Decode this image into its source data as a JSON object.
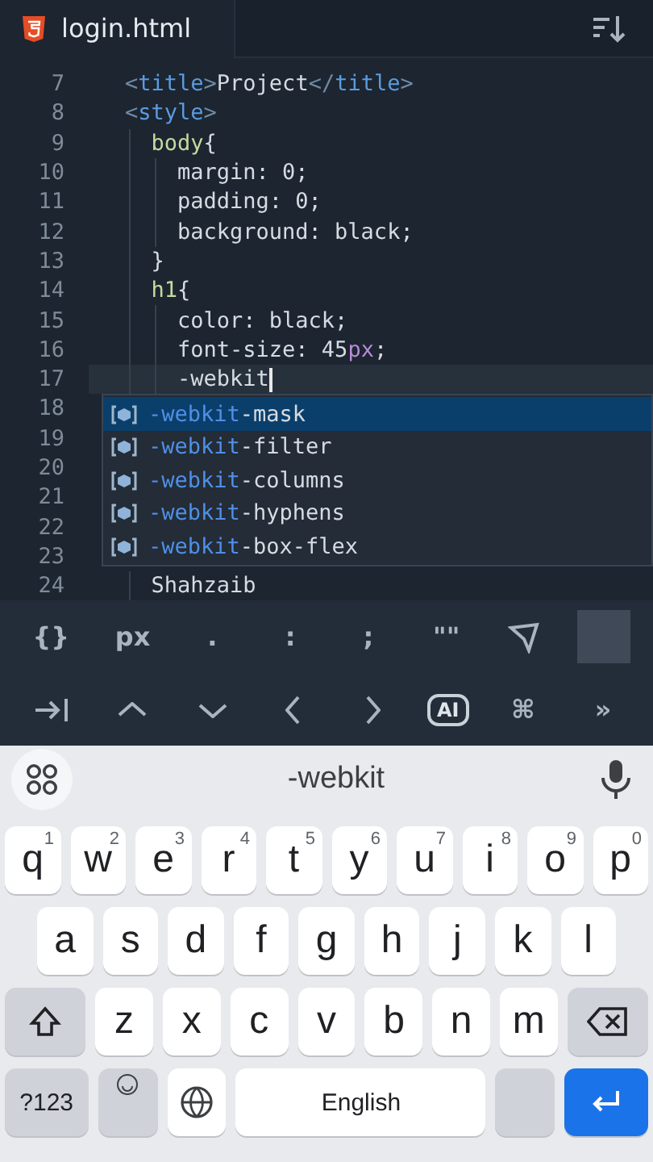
{
  "editor_tab": {
    "file_name": "login.html"
  },
  "code_lines": [
    {
      "number": "7",
      "tokens": [
        {
          "kind": "punct",
          "text": "    <"
        },
        {
          "kind": "tag",
          "text": "title"
        },
        {
          "kind": "punct",
          "text": ">"
        },
        {
          "kind": "text",
          "text": "Project"
        },
        {
          "kind": "punct",
          "text": "</"
        },
        {
          "kind": "tag",
          "text": "title"
        },
        {
          "kind": "punct",
          "text": ">"
        }
      ]
    },
    {
      "number": "8",
      "tokens": [
        {
          "kind": "punct",
          "text": "    <"
        },
        {
          "kind": "tag",
          "text": "style"
        },
        {
          "kind": "punct",
          "text": ">"
        }
      ]
    },
    {
      "number": "9",
      "tokens": [
        {
          "kind": "selector",
          "text": "      body"
        },
        {
          "kind": "text",
          "text": "{"
        }
      ]
    },
    {
      "number": "10",
      "tokens": [
        {
          "kind": "text",
          "text": "        margin: 0;"
        }
      ]
    },
    {
      "number": "11",
      "tokens": [
        {
          "kind": "text",
          "text": "        padding: 0;"
        }
      ]
    },
    {
      "number": "12",
      "tokens": [
        {
          "kind": "text",
          "text": "        background: black;"
        }
      ]
    },
    {
      "number": "13",
      "tokens": [
        {
          "kind": "text",
          "text": "      }"
        }
      ]
    },
    {
      "number": "14",
      "tokens": [
        {
          "kind": "selector",
          "text": "      h1"
        },
        {
          "kind": "text",
          "text": "{"
        }
      ]
    },
    {
      "number": "15",
      "tokens": [
        {
          "kind": "text",
          "text": "        color: black;"
        }
      ]
    },
    {
      "number": "16",
      "tokens": [
        {
          "kind": "text",
          "text": "        font-size: 45"
        },
        {
          "kind": "unit",
          "text": "px"
        },
        {
          "kind": "text",
          "text": ";"
        }
      ]
    },
    {
      "number": "17",
      "current": true,
      "tokens": [
        {
          "kind": "text",
          "text": "        -webkit"
        }
      ]
    },
    {
      "number": "18"
    },
    {
      "number": "19"
    },
    {
      "number": "20"
    },
    {
      "number": "21"
    },
    {
      "number": "22"
    },
    {
      "number": "23"
    },
    {
      "number": "24",
      "tokens": [
        {
          "kind": "text",
          "text": "      Shahzaib"
        }
      ]
    }
  ],
  "autocomplete": [
    {
      "match": "-webkit",
      "rest": "-mask",
      "selected": true
    },
    {
      "match": "-webkit",
      "rest": "-filter",
      "selected": false
    },
    {
      "match": "-webkit",
      "rest": "-columns",
      "selected": false
    },
    {
      "match": "-webkit",
      "rest": "-hyphens",
      "selected": false
    },
    {
      "match": "-webkit",
      "rest": "-box-flex",
      "selected": false
    }
  ],
  "symbol_bar": [
    {
      "kind": "text",
      "text": "{}"
    },
    {
      "kind": "text",
      "text": "px"
    },
    {
      "kind": "text",
      "text": "."
    },
    {
      "kind": "text",
      "text": ":"
    },
    {
      "kind": "text",
      "text": ";"
    },
    {
      "kind": "text",
      "text": "\"\""
    },
    {
      "kind": "send"
    },
    {
      "kind": "square"
    }
  ],
  "nav_bar": [
    {
      "kind": "tab"
    },
    {
      "kind": "up"
    },
    {
      "kind": "down"
    },
    {
      "kind": "left"
    },
    {
      "kind": "right"
    },
    {
      "kind": "badge",
      "text": "AI"
    },
    {
      "kind": "text",
      "text": "⌘"
    },
    {
      "kind": "text",
      "text": "»"
    }
  ],
  "keyboard": {
    "suggestion": "-webkit",
    "rows": [
      {
        "keys": [
          {
            "kind": "letter",
            "text": "q",
            "hint": "1"
          },
          {
            "kind": "letter",
            "text": "w",
            "hint": "2"
          },
          {
            "kind": "letter",
            "text": "e",
            "hint": "3"
          },
          {
            "kind": "letter",
            "text": "r",
            "hint": "4"
          },
          {
            "kind": "letter",
            "text": "t",
            "hint": "5"
          },
          {
            "kind": "letter",
            "text": "y",
            "hint": "6"
          },
          {
            "kind": "letter",
            "text": "u",
            "hint": "7"
          },
          {
            "kind": "letter",
            "text": "i",
            "hint": "8"
          },
          {
            "kind": "letter",
            "text": "o",
            "hint": "9"
          },
          {
            "kind": "letter",
            "text": "p",
            "hint": "0"
          }
        ]
      },
      {
        "keys": [
          {
            "kind": "letter",
            "text": "a"
          },
          {
            "kind": "letter",
            "text": "s"
          },
          {
            "kind": "letter",
            "text": "d"
          },
          {
            "kind": "letter",
            "text": "f"
          },
          {
            "kind": "letter",
            "text": "g"
          },
          {
            "kind": "letter",
            "text": "h"
          },
          {
            "kind": "letter",
            "text": "j"
          },
          {
            "kind": "letter",
            "text": "k"
          },
          {
            "kind": "letter",
            "text": "l"
          }
        ]
      },
      {
        "keys": [
          {
            "kind": "shift"
          },
          {
            "kind": "letter",
            "text": "z"
          },
          {
            "kind": "letter",
            "text": "x"
          },
          {
            "kind": "letter",
            "text": "c"
          },
          {
            "kind": "letter",
            "text": "v"
          },
          {
            "kind": "letter",
            "text": "b"
          },
          {
            "kind": "letter",
            "text": "n"
          },
          {
            "kind": "letter",
            "text": "m"
          },
          {
            "kind": "backspace"
          }
        ]
      },
      {
        "keys": [
          {
            "kind": "mode",
            "text": "?123"
          },
          {
            "kind": "emoji"
          },
          {
            "kind": "globe"
          },
          {
            "kind": "space",
            "text": "English"
          },
          {
            "kind": "period"
          },
          {
            "kind": "enter"
          }
        ]
      }
    ]
  }
}
